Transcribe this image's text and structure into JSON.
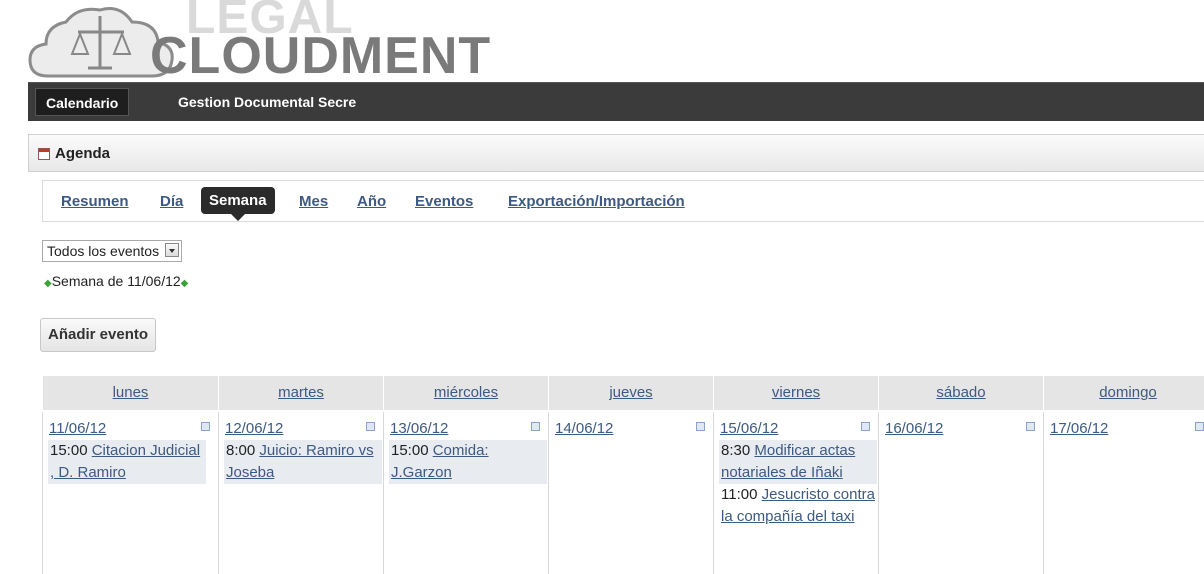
{
  "logo": {
    "line1": "LEGAL",
    "line2": "CLOUDMENT"
  },
  "topnav": {
    "items": [
      "Calendario",
      "Gestion Documental Secre"
    ]
  },
  "agenda": {
    "title": "Agenda"
  },
  "tabs": [
    "Resumen",
    "Día",
    "Semana",
    "Mes",
    "Año",
    "Eventos",
    "Exportación/Importación"
  ],
  "filter": {
    "selected": "Todos los eventos"
  },
  "week": {
    "label": "Semana de 11/06/12"
  },
  "add_button": "Añadir evento",
  "calendar": {
    "days": [
      {
        "name": "lunes",
        "date": "11/06/12",
        "events": [
          {
            "time": "15:00",
            "title": "Citacion Judicial , D. Ramiro"
          }
        ]
      },
      {
        "name": "martes",
        "date": "12/06/12",
        "events": [
          {
            "time": "8:00",
            "title": "Juicio: Ramiro vs Joseba"
          }
        ]
      },
      {
        "name": "miércoles",
        "date": "13/06/12",
        "events": [
          {
            "time": "15:00",
            "title": "Comida: J.Garzon"
          }
        ]
      },
      {
        "name": "jueves",
        "date": "14/06/12",
        "events": []
      },
      {
        "name": "viernes",
        "date": "15/06/12",
        "events": [
          {
            "time": "8:30",
            "title": "Modificar actas notariales de Iñaki"
          },
          {
            "time": "11:00",
            "title": "Jesucristo contra la compañía del taxi"
          }
        ]
      },
      {
        "name": "sábado",
        "date": "16/06/12",
        "events": []
      },
      {
        "name": "domingo",
        "date": "17/06/12",
        "events": []
      }
    ]
  }
}
